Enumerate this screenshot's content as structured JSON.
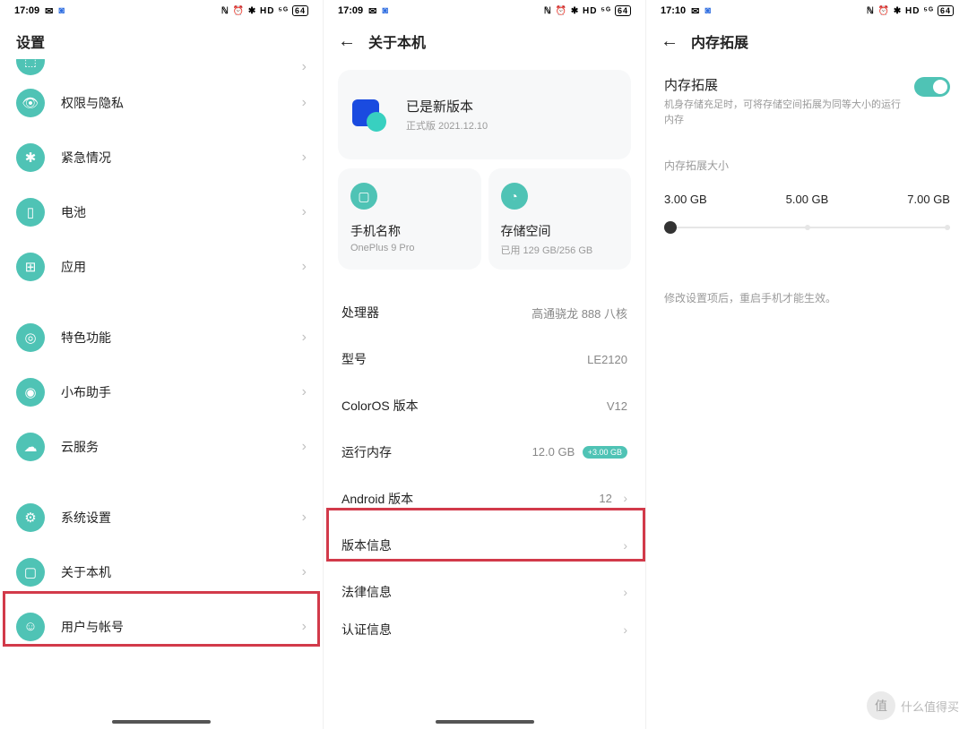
{
  "status": {
    "time1": "17:09",
    "time2": "17:09",
    "time3": "17:10",
    "battery": "64",
    "icons_right": "ℕ ⏰ ✱ HD ⁵ᴳ"
  },
  "panel1": {
    "title": "设置",
    "items": [
      {
        "icon": "⬚",
        "label": ""
      },
      {
        "icon": "👁",
        "label": "权限与隐私"
      },
      {
        "icon": "✱",
        "label": "紧急情况"
      },
      {
        "icon": "▯",
        "label": "电池"
      },
      {
        "icon": "⊞",
        "label": "应用"
      }
    ],
    "group2": [
      {
        "icon": "◎",
        "label": "特色功能"
      },
      {
        "icon": "◉",
        "label": "小布助手"
      },
      {
        "icon": "☁",
        "label": "云服务"
      }
    ],
    "group3": [
      {
        "icon": "⚙",
        "label": "系统设置"
      },
      {
        "icon": "▢",
        "label": "关于本机"
      },
      {
        "icon": "☺",
        "label": "用户与帐号"
      }
    ]
  },
  "panel2": {
    "title": "关于本机",
    "version_title": "已是新版本",
    "version_sub": "正式版 2021.12.10",
    "card_left_title": "手机名称",
    "card_left_sub": "OnePlus 9 Pro",
    "card_right_title": "存储空间",
    "card_right_sub": "已用 129 GB/256 GB",
    "specs": [
      {
        "k": "处理器",
        "v": "高通骁龙 888 八核",
        "chev": false
      },
      {
        "k": "型号",
        "v": "LE2120",
        "chev": false
      },
      {
        "k": "ColorOS 版本",
        "v": "V12",
        "chev": false
      },
      {
        "k": "运行内存",
        "v": "12.0 GB",
        "pill": "+3.00 GB",
        "chev": false,
        "hl": true
      },
      {
        "k": "Android 版本",
        "v": "12",
        "chev": true
      },
      {
        "k": "版本信息",
        "v": "",
        "chev": true
      },
      {
        "k": "法律信息",
        "v": "",
        "chev": true
      },
      {
        "k": "认证信息",
        "v": "",
        "chev": true
      }
    ]
  },
  "panel3": {
    "title": "内存拓展",
    "toggle_title": "内存拓展",
    "toggle_sub": "机身存储充足时，可将存储空间拓展为同等大小的运行内存",
    "size_label": "内存拓展大小",
    "opts": [
      "3.00 GB",
      "5.00 GB",
      "7.00 GB"
    ],
    "note": "修改设置项后，重启手机才能生效。"
  },
  "watermark": {
    "badge": "值",
    "text": "什么值得买"
  }
}
